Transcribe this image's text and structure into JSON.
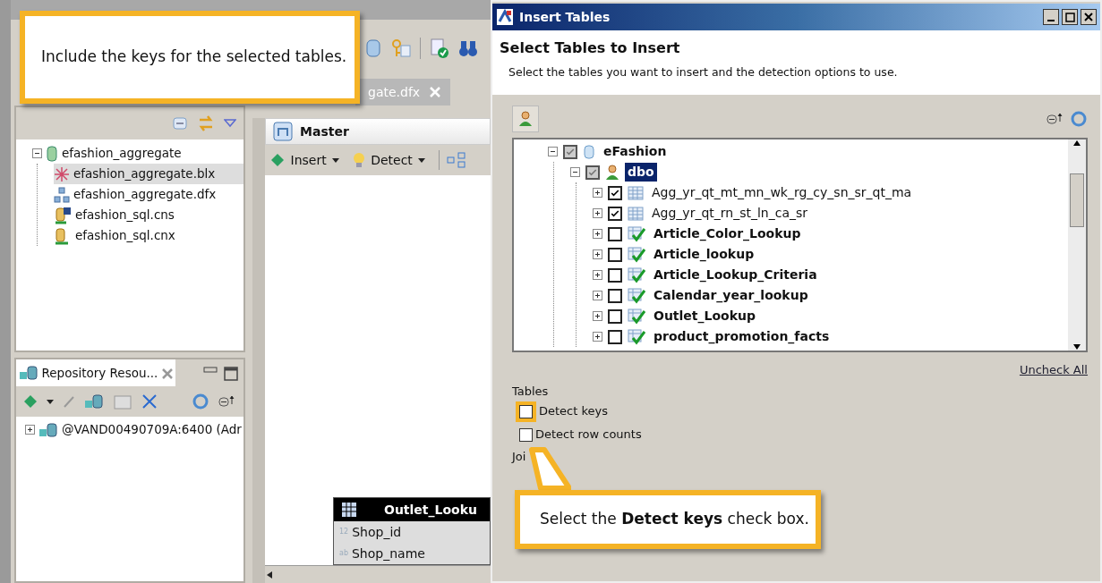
{
  "editor_tab": {
    "label": "gate.dfx"
  },
  "project_tree": [
    {
      "label": "efashion_aggregate",
      "kind": "project",
      "expanded": true,
      "selected": false,
      "children": [
        {
          "label": "efashion_aggregate.blx",
          "kind": "business_layer",
          "selected": true
        },
        {
          "label": "efashion_aggregate.dfx",
          "kind": "foundation",
          "selected": false
        },
        {
          "label": "efashion_sql.cns",
          "kind": "connection_shortcut",
          "selected": false
        },
        {
          "label": "efashion_sql.cnx",
          "kind": "connection",
          "selected": false
        }
      ]
    }
  ],
  "repository_panel": {
    "title": "Repository Resou...",
    "tree": [
      {
        "label": "@VAND00490709A:6400 (Adr",
        "expanded": false
      }
    ]
  },
  "editor": {
    "title": "Master",
    "toolbar": [
      {
        "label": "Insert",
        "kind": "insert"
      },
      {
        "label": "Detect",
        "kind": "detect"
      }
    ],
    "table": {
      "title": "Outlet_Looku",
      "columns": [
        {
          "type": "12",
          "name": "Shop_id"
        },
        {
          "type": "ab",
          "name": "Shop_name"
        }
      ]
    }
  },
  "dialog": {
    "title": "Insert Tables",
    "heading": "Select Tables to Insert",
    "description": "Select the tables you want to insert and the detection options to use.",
    "tree": [
      {
        "label": "eFashion",
        "kind": "database",
        "expanded": true,
        "checked": true,
        "partial": true,
        "selected": false,
        "children": [
          {
            "label": "dbo",
            "kind": "schema",
            "expanded": true,
            "checked": true,
            "partial": true,
            "selected": true,
            "children": [
              {
                "label": "Agg_yr_qt_mt_mn_wk_rg_cy_sn_sr_qt_ma",
                "kind": "table",
                "expanded": false,
                "checked": true,
                "partial": false,
                "selected": false
              },
              {
                "label": "Agg_yr_qt_rn_st_ln_ca_sr",
                "kind": "table",
                "expanded": false,
                "checked": true,
                "partial": false,
                "selected": false
              },
              {
                "label": "Article_Color_Lookup",
                "kind": "detected_table",
                "expanded": false,
                "checked": false,
                "partial": false,
                "selected": false
              },
              {
                "label": "Article_lookup",
                "kind": "detected_table",
                "expanded": false,
                "checked": false,
                "partial": false,
                "selected": false
              },
              {
                "label": "Article_Lookup_Criteria",
                "kind": "detected_table",
                "expanded": false,
                "checked": false,
                "partial": false,
                "selected": false
              },
              {
                "label": "Calendar_year_lookup",
                "kind": "detected_table",
                "expanded": false,
                "checked": false,
                "partial": false,
                "selected": false
              },
              {
                "label": "Outlet_Lookup",
                "kind": "detected_table",
                "expanded": false,
                "checked": false,
                "partial": false,
                "selected": false
              },
              {
                "label": "product_promotion_facts",
                "kind": "detected_table",
                "expanded": false,
                "checked": false,
                "partial": false,
                "selected": false
              }
            ]
          }
        ]
      }
    ],
    "uncheck_all": "Uncheck All",
    "options_label": "Tables",
    "options": [
      {
        "label": "Detect keys",
        "checked": false,
        "highlighted": true
      },
      {
        "label": "Detect row counts",
        "checked": false,
        "highlighted": false
      }
    ],
    "joins_label": "Joi"
  },
  "callouts": [
    {
      "text": "Include the keys for the selected tables."
    },
    {
      "text": "Select the **Detect keys** check box."
    }
  ]
}
